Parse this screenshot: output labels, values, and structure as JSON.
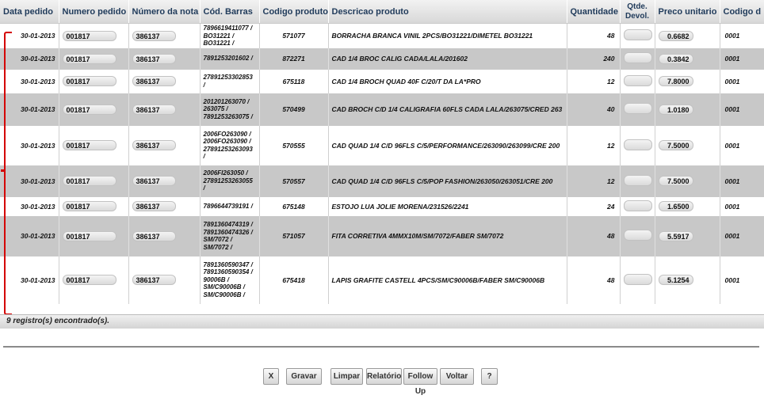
{
  "columns": [
    "Data pedido",
    "Numero pedido",
    "Número da nota",
    "Cód. Barras",
    "Codigo produto",
    "Descricao produto",
    "Quantidade",
    "Qtde. Devol.",
    "Preco unitario",
    "Codigo d"
  ],
  "rows": [
    {
      "date": "30-01-2013",
      "order": "001817",
      "invoice": "386137",
      "barcode": "7896619411077 / BO31221 / BO31221 /",
      "product_code": "571077",
      "description": "BORRACHA BRANCA VINIL 2PCS/BO31221/DIMETEL BO31221",
      "quantity": "48",
      "returned": "",
      "unit_price": "0.6682",
      "code": "0001"
    },
    {
      "date": "30-01-2013",
      "order": "001817",
      "invoice": "386137",
      "barcode": "7891253201602 /",
      "product_code": "872271",
      "description": "CAD 1/4 BROC CALIG CADA/LALA/201602",
      "quantity": "240",
      "returned": "",
      "unit_price": "0.3842",
      "code": "0001"
    },
    {
      "date": "30-01-2013",
      "order": "001817",
      "invoice": "386137",
      "barcode": "27891253302853 /",
      "product_code": "675118",
      "description": "CAD 1/4 BROCH QUAD 40F C/20/T DA LA*PRO",
      "quantity": "12",
      "returned": "",
      "unit_price": "7.8000",
      "code": "0001"
    },
    {
      "date": "30-01-2013",
      "order": "001817",
      "invoice": "386137",
      "barcode": "201201263070 / 263075 / 7891253263075 /",
      "product_code": "570499",
      "description": "CAD BROCH C/D 1/4 CALIGRAFIA 60FLS CADA LALA/263075/CRED 263",
      "quantity": "40",
      "returned": "",
      "unit_price": "1.0180",
      "code": "0001"
    },
    {
      "date": "30-01-2013",
      "order": "001817",
      "invoice": "386137",
      "barcode": "2006FO263090 / 2006FO263090 / 27891253263093 /",
      "product_code": "570555",
      "description": "CAD QUAD 1/4 C/D 96FLS C/5/PERFORMANCE/263090/263099/CRE 200",
      "quantity": "12",
      "returned": "",
      "unit_price": "7.5000",
      "code": "0001"
    },
    {
      "date": "30-01-2013",
      "order": "001817",
      "invoice": "386137",
      "barcode": "2006FI263050 / 27891253263055 /",
      "product_code": "570557",
      "description": "CAD QUAD 1/4 C/D 96FLS C/5/POP FASHION/263050/263051/CRE 200",
      "quantity": "12",
      "returned": "",
      "unit_price": "7.5000",
      "code": "0001"
    },
    {
      "date": "30-01-2013",
      "order": "001817",
      "invoice": "386137",
      "barcode": "7896644739191 /",
      "product_code": "675148",
      "description": "ESTOJO LUA JOLIE MORENA/231526/2241",
      "quantity": "24",
      "returned": "",
      "unit_price": "1.6500",
      "code": "0001"
    },
    {
      "date": "30-01-2013",
      "order": "001817",
      "invoice": "386137",
      "barcode": "7891360474319 / 7891360474326 / SM/7072 / SM/7072 /",
      "product_code": "571057",
      "description": "FITA CORRETIVA 4MMX10M/SM/7072/FABER SM/7072",
      "quantity": "48",
      "returned": "",
      "unit_price": "5.5917",
      "code": "0001"
    },
    {
      "date": "30-01-2013",
      "order": "001817",
      "invoice": "386137",
      "barcode": "7891360590347 / 7891360590354 / 90006B / SM/C90006B / SM/C90006B /",
      "product_code": "675418",
      "description": "LAPIS GRAFITE CASTELL 4PCS/SM/C90006B/FABER SM/C90006B",
      "quantity": "48",
      "returned": "",
      "unit_price": "5.1254",
      "code": "0001"
    }
  ],
  "row_heights": [],
  "footer": {
    "records_text": "9 registro(s) encontrado(s)."
  },
  "buttons": {
    "close": "X",
    "save": "Gravar",
    "clear": "Limpar",
    "report": "Relatório",
    "follow_up": "Follow Up",
    "back": "Voltar",
    "help": "?"
  },
  "colors": {
    "header_text": "#1f3a5a",
    "stripe": "#c8c8c8",
    "highlight": "#d40000"
  }
}
